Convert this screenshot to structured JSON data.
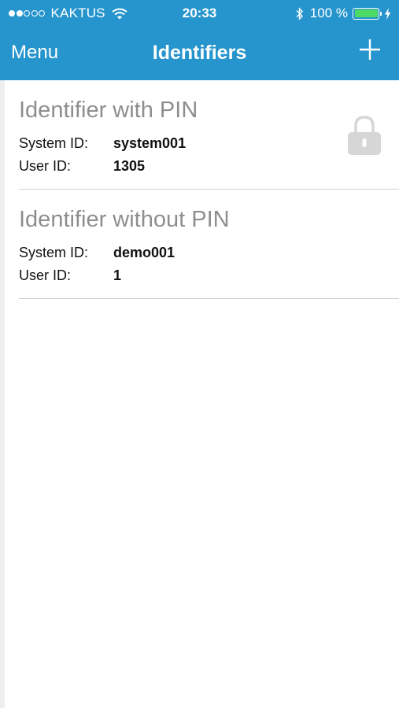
{
  "status_bar": {
    "carrier": "KAKTUS",
    "time": "20:33",
    "battery_percent": "100 %",
    "signal_bars_filled": 2,
    "signal_bars_total": 5
  },
  "nav": {
    "menu_label": "Menu",
    "title": "Identifiers",
    "add_icon": "plus-icon"
  },
  "identifiers": [
    {
      "name": "Identifier with PIN",
      "system_id_label": "System ID:",
      "system_id": "system001",
      "user_id_label": "User ID:",
      "user_id": "1305",
      "locked": true
    },
    {
      "name": "Identifier without PIN",
      "system_id_label": "System ID:",
      "system_id": "demo001",
      "user_id_label": "User ID:",
      "user_id": "1",
      "locked": false
    }
  ],
  "colors": {
    "nav_background": "#2795cd",
    "battery": "#4cd964",
    "title_gray": "#8e8e8e",
    "lock_gray": "#d6d6d6"
  }
}
